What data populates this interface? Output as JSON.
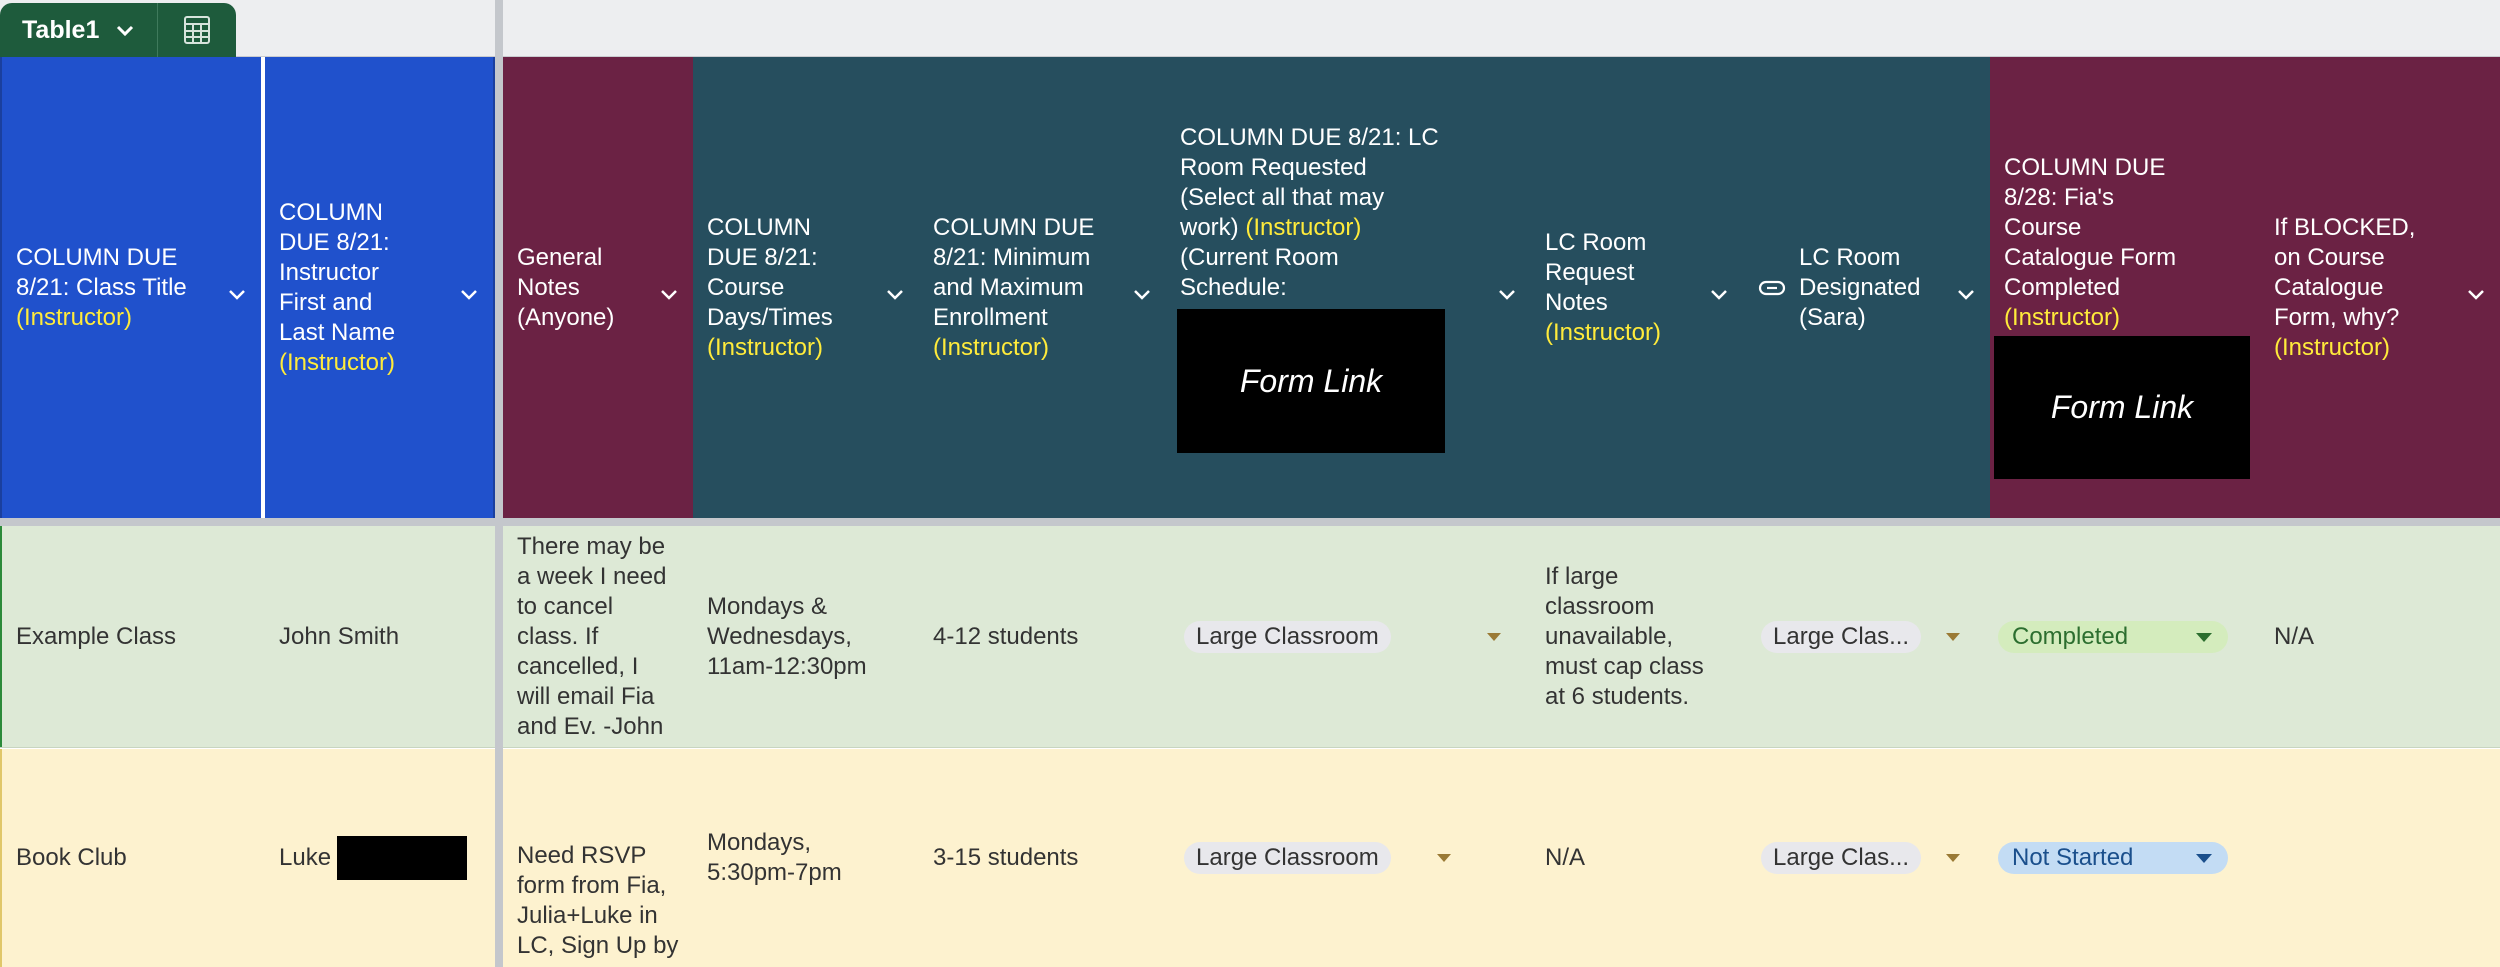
{
  "tab": {
    "name": "Table1"
  },
  "icons": {
    "tab_chevron": "chevron-down-icon",
    "calc": "calculator-icon",
    "link": "link-icon",
    "column_menu": "chevron-down-icon"
  },
  "colors": {
    "blue_header": "#2051cc",
    "maroon_header": "#6b2244",
    "teal_header": "#264e5e",
    "highlight_text": "#ffeb3b",
    "row_green": "#dde9d6",
    "row_yellow": "#fdf2cf",
    "tab_green": "#1e5b3c"
  },
  "form_link_label": "Form Link",
  "columns": [
    {
      "id": "class-title",
      "label": "COLUMN DUE\n8/21: Class Title",
      "tag": "(Instructor)"
    },
    {
      "id": "instructor-name",
      "label": "COLUMN\nDUE 8/21:\nInstructor\nFirst and\nLast Name",
      "tag": "(Instructor)"
    },
    {
      "id": "general-notes",
      "label": "General\nNotes\n(Anyone)",
      "tag": ""
    },
    {
      "id": "course-days",
      "label": "COLUMN\nDUE 8/21:\nCourse\nDays/Times",
      "tag": "(Instructor)"
    },
    {
      "id": "enrollment",
      "label": "COLUMN DUE\n8/21: Minimum\nand Maximum\nEnrollment",
      "tag": "(Instructor)"
    },
    {
      "id": "room-requested",
      "label_a": "COLUMN DUE 8/21: LC\nRoom Requested\n(Select all that may\nwork) ",
      "tag": "(Instructor)",
      "label_b": "\n(Current Room\nSchedule:"
    },
    {
      "id": "room-notes",
      "label": "LC Room\nRequest\nNotes",
      "tag": "(Instructor)"
    },
    {
      "id": "room-designated",
      "label": "LC Room\nDesignated\n(Sara)",
      "tag": ""
    },
    {
      "id": "catalogue-form",
      "label": "COLUMN DUE\n8/28: Fia's\nCourse\nCatalogue Form\nCompleted",
      "tag": "(Instructor)"
    },
    {
      "id": "blocked-reason",
      "label": "If BLOCKED,\non Course\nCatalogue\nForm, why?",
      "tag": "(Instructor)"
    }
  ],
  "rows": [
    {
      "class_title": "Example Class",
      "instructor": "John Smith",
      "notes": "There may be\na week I need\nto cancel\nclass. If\ncancelled, I\nwill email Fia\nand Ev. -John",
      "days": "Mondays &\nWednesdays,\n11am-12:30pm",
      "enrollment": "4-12 students",
      "room_requested": "Large Classroom",
      "room_notes": "If large\nclassroom\nunavailable,\nmust cap class\nat 6 students.",
      "room_designated": "Large Clas...",
      "catalogue_status": "Completed",
      "blocked_reason": "N/A"
    },
    {
      "class_title": "Book Club",
      "instructor": "Luke",
      "notes": "Need RSVP\nform from Fia,\nJulia+Luke in\nLC, Sign Up by",
      "days": "Mondays,\n5:30pm-7pm",
      "enrollment": "3-15 students",
      "room_requested": "Large Classroom",
      "room_notes": "N/A",
      "room_designated": "Large Clas...",
      "catalogue_status": "Not Started",
      "blocked_reason": ""
    }
  ]
}
